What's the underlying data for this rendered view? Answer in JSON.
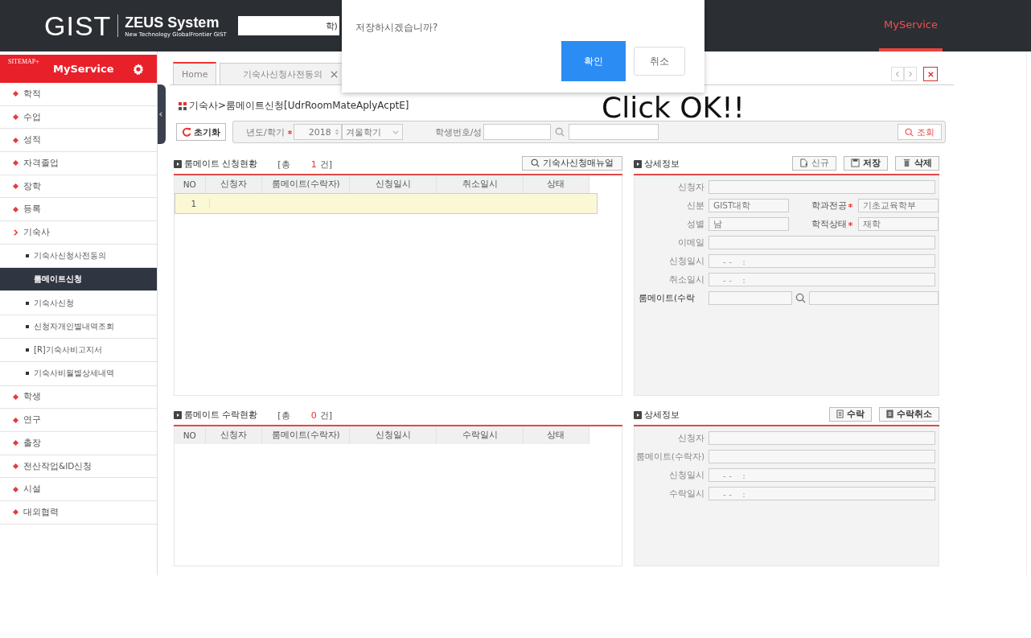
{
  "header": {
    "logo": "GIST",
    "system_name": "ZEUS System",
    "tagline": "New Technology GlobalFrontier GIST",
    "user_fragment": "학)",
    "nav": [
      {
        "label": "MyService",
        "selected": true
      }
    ]
  },
  "sidebar": {
    "sitemap": "SITEMAP+",
    "title": "MyService",
    "items": [
      {
        "label": "학적",
        "expanded": false
      },
      {
        "label": "수업",
        "expanded": false
      },
      {
        "label": "성적",
        "expanded": false
      },
      {
        "label": "자격졸업",
        "expanded": false
      },
      {
        "label": "장학",
        "expanded": false
      },
      {
        "label": "등록",
        "expanded": false
      },
      {
        "label": "기숙사",
        "expanded": true,
        "children": [
          {
            "label": "기숙사신청사전동의",
            "selected": false
          },
          {
            "label": "룸메이트신청",
            "selected": true
          },
          {
            "label": "기숙사신청",
            "selected": false
          },
          {
            "label": "신청자개인별내역조회",
            "selected": false
          },
          {
            "label": "[R]기숙사비고지서",
            "selected": false
          },
          {
            "label": "기숙사비월별상세내역",
            "selected": false
          }
        ]
      },
      {
        "label": "학생",
        "expanded": false
      },
      {
        "label": "연구",
        "expanded": false
      },
      {
        "label": "출장",
        "expanded": false
      },
      {
        "label": "전산작업&ID신청",
        "expanded": false
      },
      {
        "label": "시설",
        "expanded": false
      },
      {
        "label": "대외협력",
        "expanded": false
      }
    ]
  },
  "tabs": [
    {
      "label": "Home",
      "selected": true,
      "closable": false
    },
    {
      "label": "기숙사신청사전동의",
      "selected": false,
      "closable": true
    }
  ],
  "page_title": "기숙사>룸메이트신청[UdrRoomMateAplyAcptE]",
  "toolbar": {
    "reset": "초기화",
    "year_label": "년도/학기",
    "year": "2018",
    "semester": "겨울학기",
    "student_label": "학생번호/성",
    "search": "조회"
  },
  "application_panel": {
    "title": "룸메이트 신청현황",
    "count_open": "[총",
    "count": "1",
    "count_close": "건]",
    "manual_button": "기숙사신청매뉴얼",
    "columns": [
      "NO",
      "신청자",
      "룸메이트(수락자)",
      "신청일시",
      "취소일시",
      "상태"
    ],
    "rows": [
      {
        "no": "1",
        "selected": true
      }
    ]
  },
  "application_detail": {
    "title": "상세정보",
    "buttons": [
      {
        "label": "신규",
        "kind": "new"
      },
      {
        "label": "저장",
        "kind": "save"
      },
      {
        "label": "삭제",
        "kind": "delete"
      }
    ],
    "fields": [
      {
        "kind": "single",
        "label": "신청자"
      },
      {
        "kind": "pair",
        "items": [
          {
            "label": "신분",
            "value": "GIST대학",
            "required": false
          },
          {
            "label": "학과전공",
            "value": "기초교육학부",
            "required": true
          }
        ]
      },
      {
        "kind": "pair",
        "items": [
          {
            "label": "성별",
            "value": "남",
            "required": false
          },
          {
            "label": "학적상태",
            "value": "재학",
            "required": true
          }
        ]
      },
      {
        "kind": "single",
        "label": "이메일"
      },
      {
        "kind": "single",
        "label": "신청일시",
        "value": "- -    :"
      },
      {
        "kind": "single",
        "label": "취소일시",
        "value": "- -    :"
      },
      {
        "kind": "lookup",
        "label": "룸메이트(수락"
      }
    ]
  },
  "acceptance_panel": {
    "title": "룸메이트 수락현황",
    "count_open": "[총",
    "count": "0",
    "count_close": "건]",
    "columns": [
      "NO",
      "신청자",
      "룸메이트(수락자)",
      "신청일시",
      "수락일시",
      "상태"
    ]
  },
  "acceptance_detail": {
    "title": "상세정보",
    "buttons": [
      {
        "label": "수락",
        "kind": "accept"
      },
      {
        "label": "수락취소",
        "kind": "accept_cancel"
      }
    ],
    "fields": [
      {
        "kind": "single",
        "label": "신청자"
      },
      {
        "kind": "single",
        "label": "룸메이트(수락자)"
      },
      {
        "kind": "single",
        "label": "신청일시",
        "value": "- -    :"
      },
      {
        "kind": "single",
        "label": "수락일시",
        "value": "- -    :"
      }
    ]
  },
  "dialog": {
    "message": "저장하시겠습니까?",
    "buttons": [
      {
        "label": "확인",
        "primary": true,
        "highlighted": true
      },
      {
        "label": "취소",
        "primary": false,
        "highlighted": false
      }
    ]
  },
  "annotation": "Click OK!!"
}
